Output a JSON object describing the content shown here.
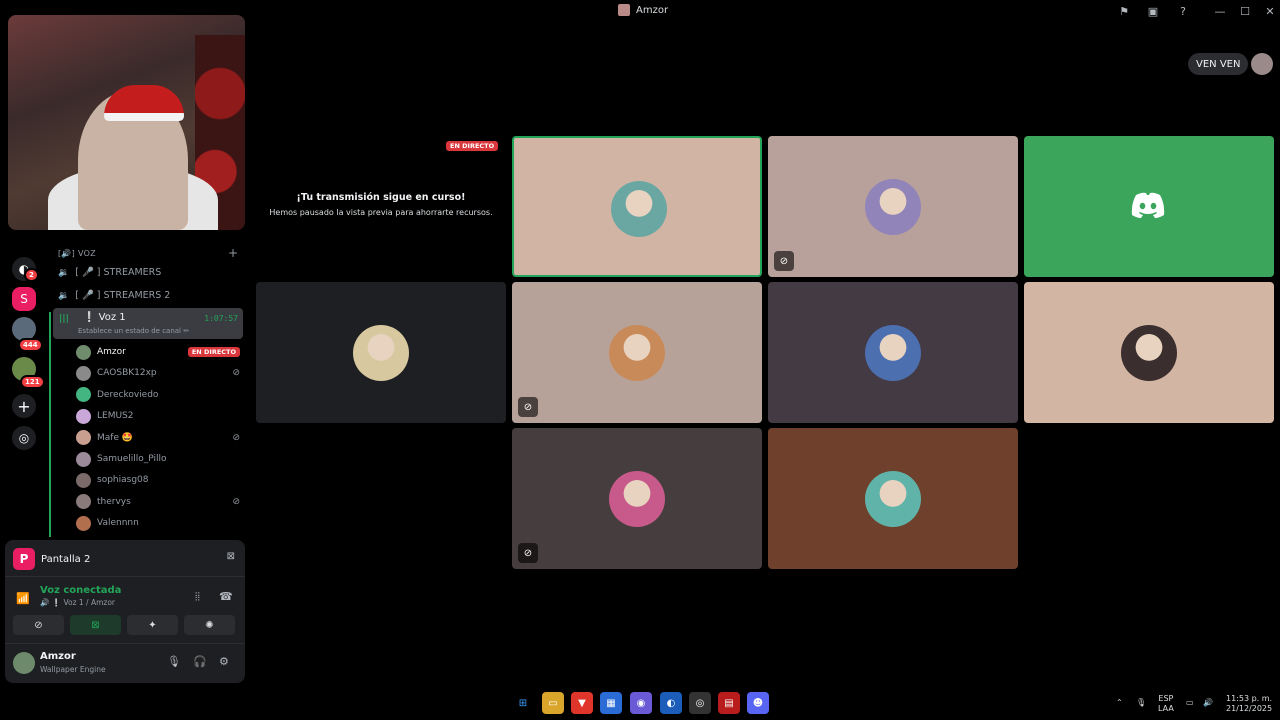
{
  "window": {
    "title": "Amzor"
  },
  "titlebar_icons": [
    "inbox-icon",
    "window-icon",
    "help-icon",
    "minimize-icon",
    "maximize-icon",
    "close-icon"
  ],
  "rail": {
    "badges": [
      "2",
      "444",
      "121"
    ]
  },
  "channels": {
    "category": "[🔊] VOZ",
    "items": [
      {
        "label": "[ 🎤 ] STREAMERS"
      },
      {
        "label": "[ 🎤 ] STREAMERS 2"
      }
    ],
    "active": {
      "label": "❕ Voz 1",
      "time": "1:07:57",
      "status": "Establece un estado de canal ✏"
    },
    "members": [
      {
        "name": "Amzor",
        "live": "EN DIRECTO",
        "muted": false,
        "color": "#6f8d6c"
      },
      {
        "name": "CAOSBK12xp",
        "live": "",
        "muted": true,
        "color": "#8a8a8a"
      },
      {
        "name": "Dereckoviedo",
        "live": "",
        "muted": false,
        "color": "#43b581"
      },
      {
        "name": "LEMUS2",
        "live": "",
        "muted": false,
        "color": "#c9a7d8"
      },
      {
        "name": "Mafe 🤩",
        "live": "",
        "muted": true,
        "color": "#c9a090"
      },
      {
        "name": "Samuelillo_Pillo",
        "live": "",
        "muted": false,
        "color": "#9a8a9a"
      },
      {
        "name": "sophiasg08",
        "live": "",
        "muted": false,
        "color": "#7a6a6a"
      },
      {
        "name": "thervys",
        "live": "",
        "muted": true,
        "color": "#8a7a7a"
      },
      {
        "name": "Valennnn",
        "live": "",
        "muted": false,
        "color": "#b26f4e"
      }
    ]
  },
  "panel": {
    "screen_label": "Pantalla 2",
    "screen_icon_letter": "P",
    "voice_title": "Voz conectada",
    "voice_sub": "🔊 ❕ Voz 1 / Amzor",
    "user_name": "Amzor",
    "user_status": "Wallpaper Engine"
  },
  "top_pill": {
    "label": "VEN VEN"
  },
  "stream": {
    "live_tag": "EN DIRECTO",
    "title": "¡Tu transmisión sigue en curso!",
    "subtitle": "Hemos pausado la vista previa para ahorrarte recursos."
  },
  "tiles": [
    {
      "bg": "#d2b4a5",
      "avatar": "#6aa7a3",
      "speaking": true,
      "muted": false
    },
    {
      "bg": "#b8a19b",
      "avatar": "#9184b8",
      "speaking": false,
      "muted": true
    },
    {
      "bg": "#3ba55c",
      "avatar": "",
      "speaking": false,
      "muted": false,
      "discord": true
    },
    {
      "bg": "#1e1f22",
      "avatar": "#d8c8a0",
      "speaking": false,
      "muted": false
    },
    {
      "bg": "#b7a29a",
      "avatar": "#c98a5a",
      "speaking": false,
      "muted": true
    },
    {
      "bg": "#433a43",
      "avatar": "#4c6fb0",
      "speaking": false,
      "muted": false
    },
    {
      "bg": "#d3b5a4",
      "avatar": "#3a2e2e",
      "speaking": false,
      "muted": false
    },
    {
      "bg": "#463e3e",
      "avatar": "#c75a8a",
      "speaking": false,
      "muted": true
    },
    {
      "bg": "#6f402b",
      "avatar": "#5fb3a8",
      "speaking": false,
      "muted": false
    }
  ],
  "taskbar": {
    "lang_top": "ESP",
    "lang_bottom": "LAA",
    "time": "11:53 p. m.",
    "date": "21/12/2025"
  }
}
